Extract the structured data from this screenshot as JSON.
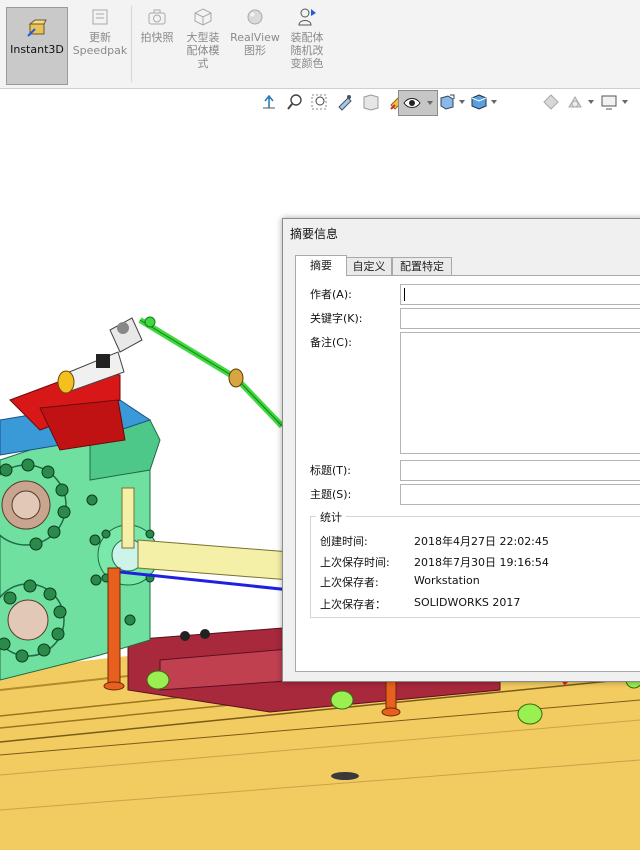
{
  "ribbon": {
    "buttons": [
      {
        "label": "Instant3D"
      },
      {
        "label": "更新\nSpeedpak"
      },
      {
        "label": "拍快照"
      },
      {
        "label": "大型装\n配体模\n式"
      },
      {
        "label": "RealView\n图形"
      },
      {
        "label": "装配体\n随机改\n变颜色"
      }
    ]
  },
  "dialog": {
    "title": "摘要信息",
    "tabs": [
      "摘要",
      "自定义",
      "配置特定"
    ],
    "fields": {
      "author_label": "作者(A):",
      "author_value": "",
      "keywords_label": "关键字(K):",
      "keywords_value": "",
      "comments_label": "备注(C):",
      "comments_value": "",
      "title_label": "标题(T):",
      "title_value": "",
      "subject_label": "主题(S):",
      "subject_value": ""
    },
    "stats": {
      "group_title": "统计",
      "created_label": "创建时间:",
      "created_value": "2018年4月27日 22:02:45",
      "last_saved_label": "上次保存时间:",
      "last_saved_value": "2018年7月30日 19:16:54",
      "saved_by_label": "上次保存者:",
      "saved_by_value": "Workstation",
      "saved_with_label": "上次保存者：",
      "saved_with_value": "SOLIDWORKS 2017"
    }
  },
  "colors": {
    "machine_body": "#6fe0a0",
    "red_part": "#d81818",
    "rod_green": "#3fd83f",
    "shaft_yellow": "#f5f0a8",
    "base": "#f2cc60",
    "annotation_arrow": "#e02020"
  }
}
